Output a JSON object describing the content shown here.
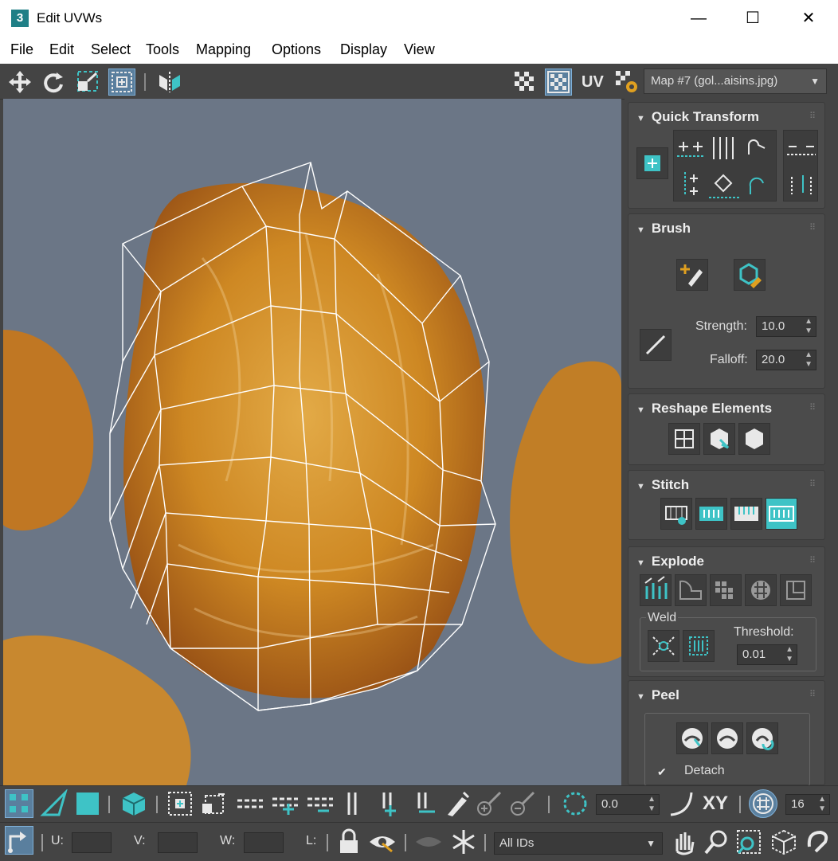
{
  "window": {
    "icon_text": "3",
    "title": "Edit UVWs",
    "minimize": "—",
    "maximize": "☐",
    "close": "✕"
  },
  "menu": {
    "items": [
      "File",
      "Edit",
      "Select",
      "Tools",
      "Mapping",
      "Options",
      "Display",
      "View"
    ]
  },
  "toolbar": {
    "uv_label": "UV",
    "map_selector": "Map #7 (gol...aisins.jpg)"
  },
  "panel": {
    "quick_transform": {
      "title": "Quick Transform"
    },
    "brush": {
      "title": "Brush",
      "strength_label": "Strength:",
      "strength_value": "10.0",
      "falloff_label": "Falloff:",
      "falloff_value": "20.0"
    },
    "reshape": {
      "title": "Reshape Elements"
    },
    "stitch": {
      "title": "Stitch"
    },
    "explode": {
      "title": "Explode",
      "weld_label": "Weld",
      "threshold_label": "Threshold:",
      "threshold_value": "0.01"
    },
    "peel": {
      "title": "Peel",
      "detach_label": "Detach"
    }
  },
  "bottom": {
    "angle_value": "0.0",
    "xy_label": "XY",
    "grid_value": "16",
    "u_label": "U:",
    "v_label": "V:",
    "w_label": "W:",
    "l_label": "L:",
    "ids_value": "All IDs"
  },
  "colors": {
    "accent": "#3ec3c6",
    "viewport_bg": "#6b7686",
    "panel_bg": "#444444",
    "raisin": "#d9860f"
  }
}
